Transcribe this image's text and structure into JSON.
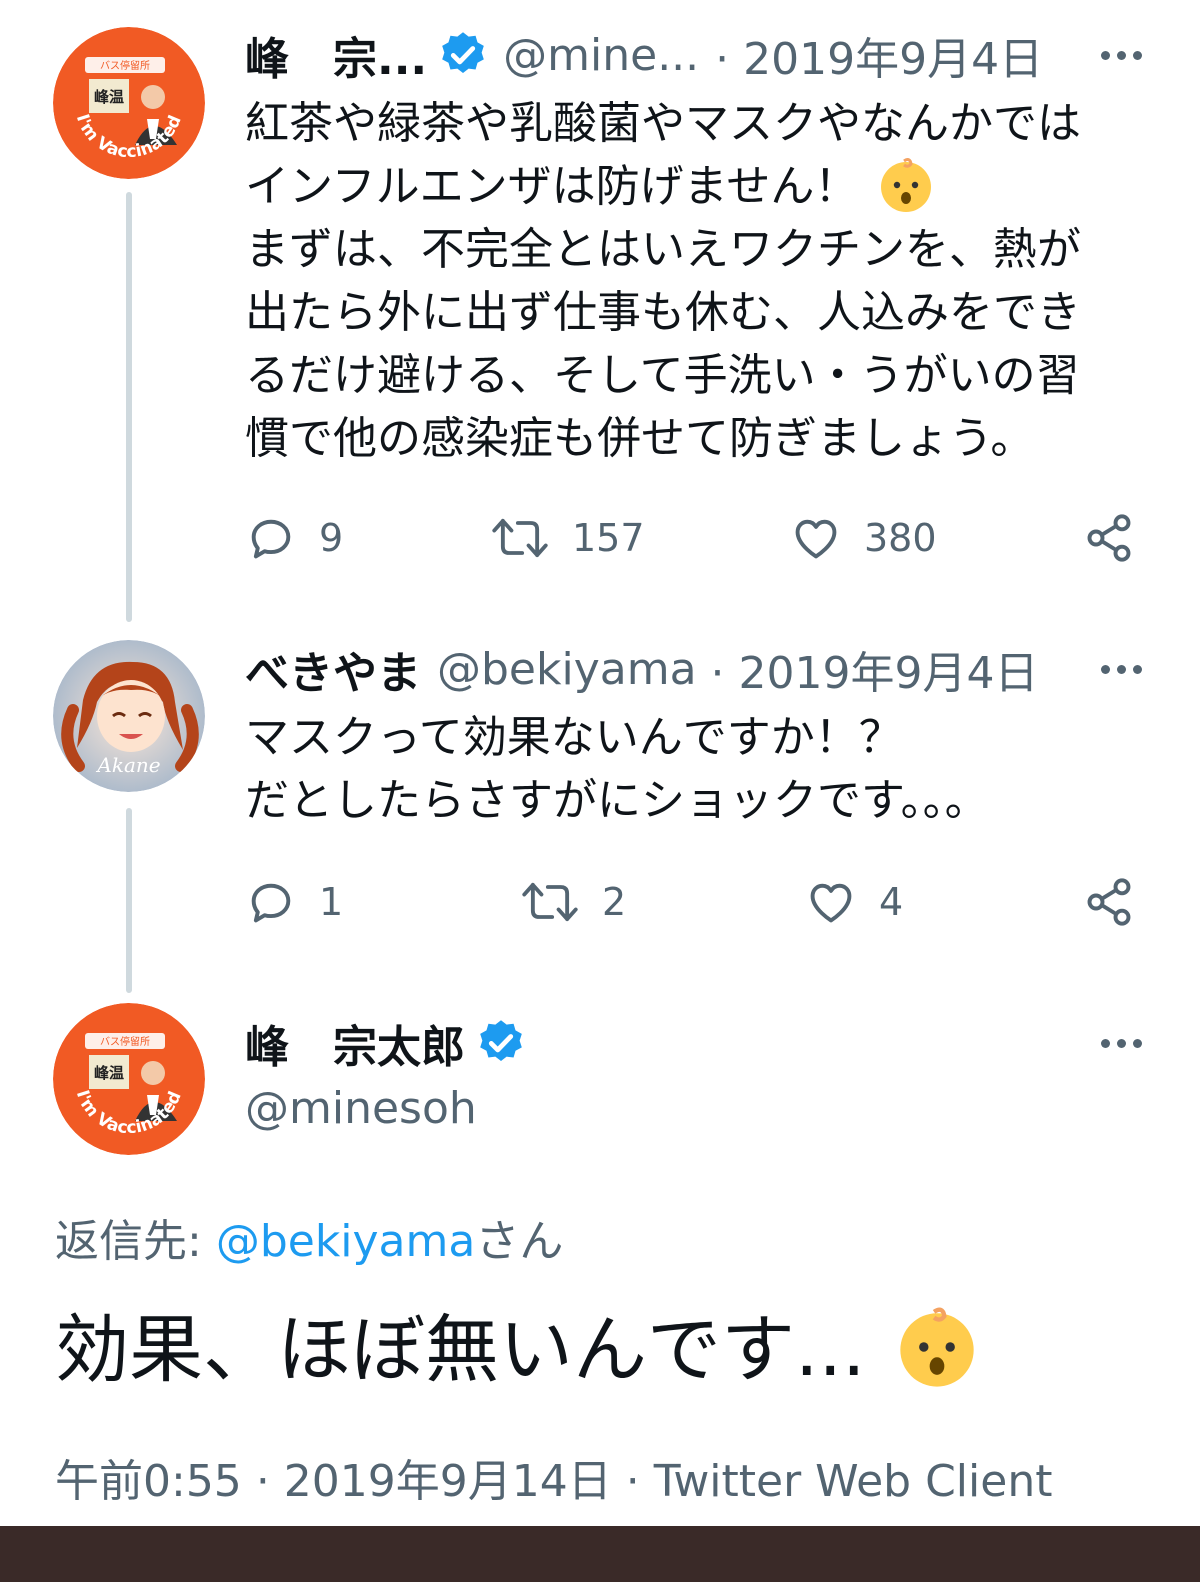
{
  "tweets": [
    {
      "name": "峰　宗...",
      "handle": "@mine...",
      "date": "· 2019年9月4日",
      "lines": [
        "紅茶や緑茶や乳酸菌やマスクやなんかでは",
        "インフルエンザは防げません！",
        "まずは、不完全とはいえワクチンを、熱が",
        "出たら外に出ず仕事も休む、人込みをでき",
        "るだけ避ける、そして手洗い・うがいの習",
        "慣で他の感染症も併せて防ぎましょう。"
      ],
      "emoji": "baby-face-emoji",
      "replies": "9",
      "retweets": "157",
      "likes": "380"
    },
    {
      "name": "べきやま",
      "handle": "@bekiyama",
      "date": "· 2019年9月4日",
      "lines": [
        "マスクって効果ないんですか！？",
        "だとしたらさすがにショックです。。。"
      ],
      "replies": "1",
      "retweets": "2",
      "likes": "4"
    }
  ],
  "main_tweet": {
    "name": "峰　宗太郎",
    "handle": "@minesoh",
    "reply_prefix": "返信先: ",
    "reply_handle": "@bekiyama",
    "reply_suffix": "さん",
    "text": "効果、ほぼ無いんです...",
    "emoji": "baby-face-emoji",
    "time": "午前0:55",
    "date": "· 2019年9月14日 ·",
    "client": "Twitter Web Client"
  },
  "avatar_texts": {
    "badge_top": "バス停留所",
    "badge_sign": "峰温",
    "badge_ring": "I'm Vaccinated",
    "second_ring": "Akane"
  },
  "icons": {
    "verified": "verified-badge-icon",
    "more": "more-options-icon",
    "reply": "reply-icon",
    "retweet": "retweet-icon",
    "like": "heart-icon",
    "share": "share-icon"
  },
  "colors": {
    "accent": "#1d9bf0",
    "secondary_text": "#536471",
    "primary_text": "#0f1419",
    "thread_line": "#cfd9de",
    "avatar_orange": "#f15a24"
  }
}
